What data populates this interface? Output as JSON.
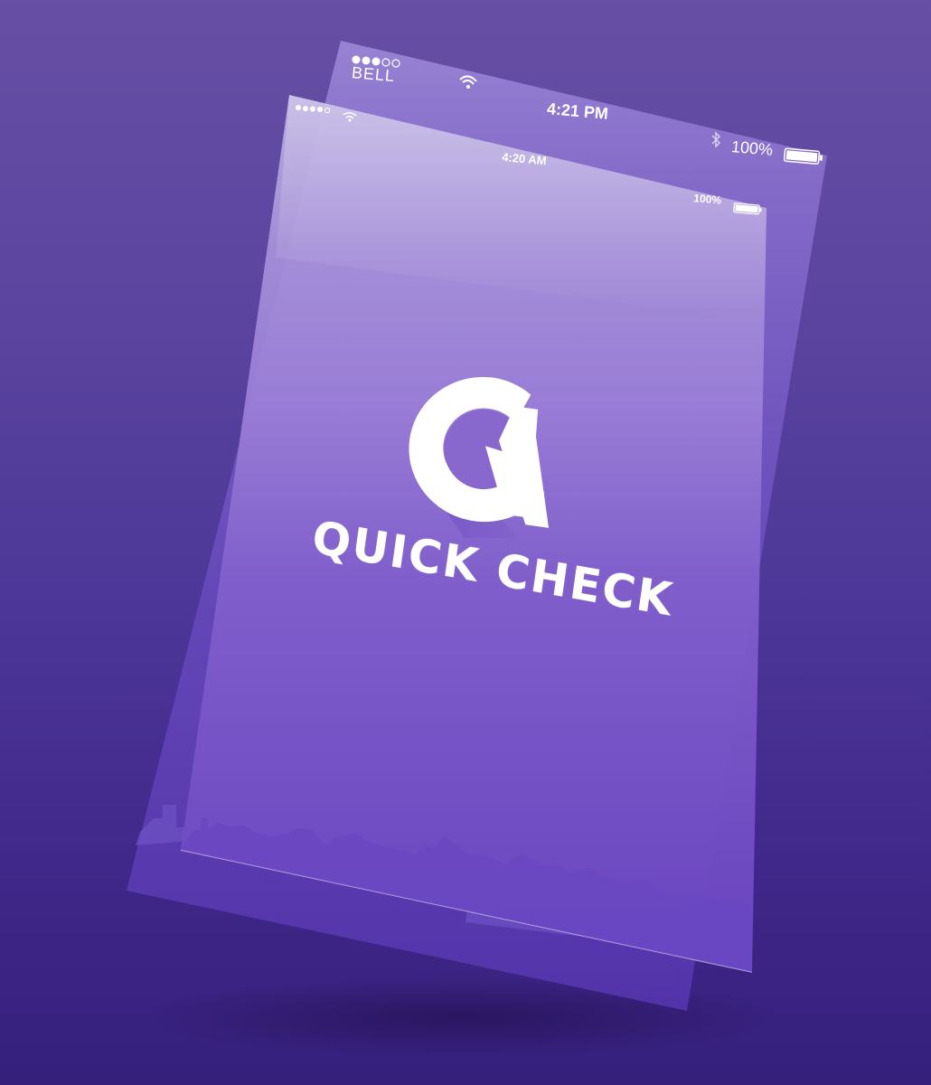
{
  "back_screen": {
    "status_bar": {
      "carrier": "BELL",
      "time": "4:21 PM",
      "battery": "100%"
    }
  },
  "front_screen": {
    "status_bar": {
      "time": "4:20 AM",
      "battery": "100%"
    },
    "logo_icon": "q-logo-icon",
    "brand_name": "QUICK CHECK",
    "skyline": "city-skyline-silhouette"
  },
  "colors": {
    "background_top": "#664fa4",
    "background_bottom": "#35207c",
    "screen_top": "#b4a6dc",
    "screen_bottom": "#6c46c2",
    "logo": "#ffffff"
  }
}
